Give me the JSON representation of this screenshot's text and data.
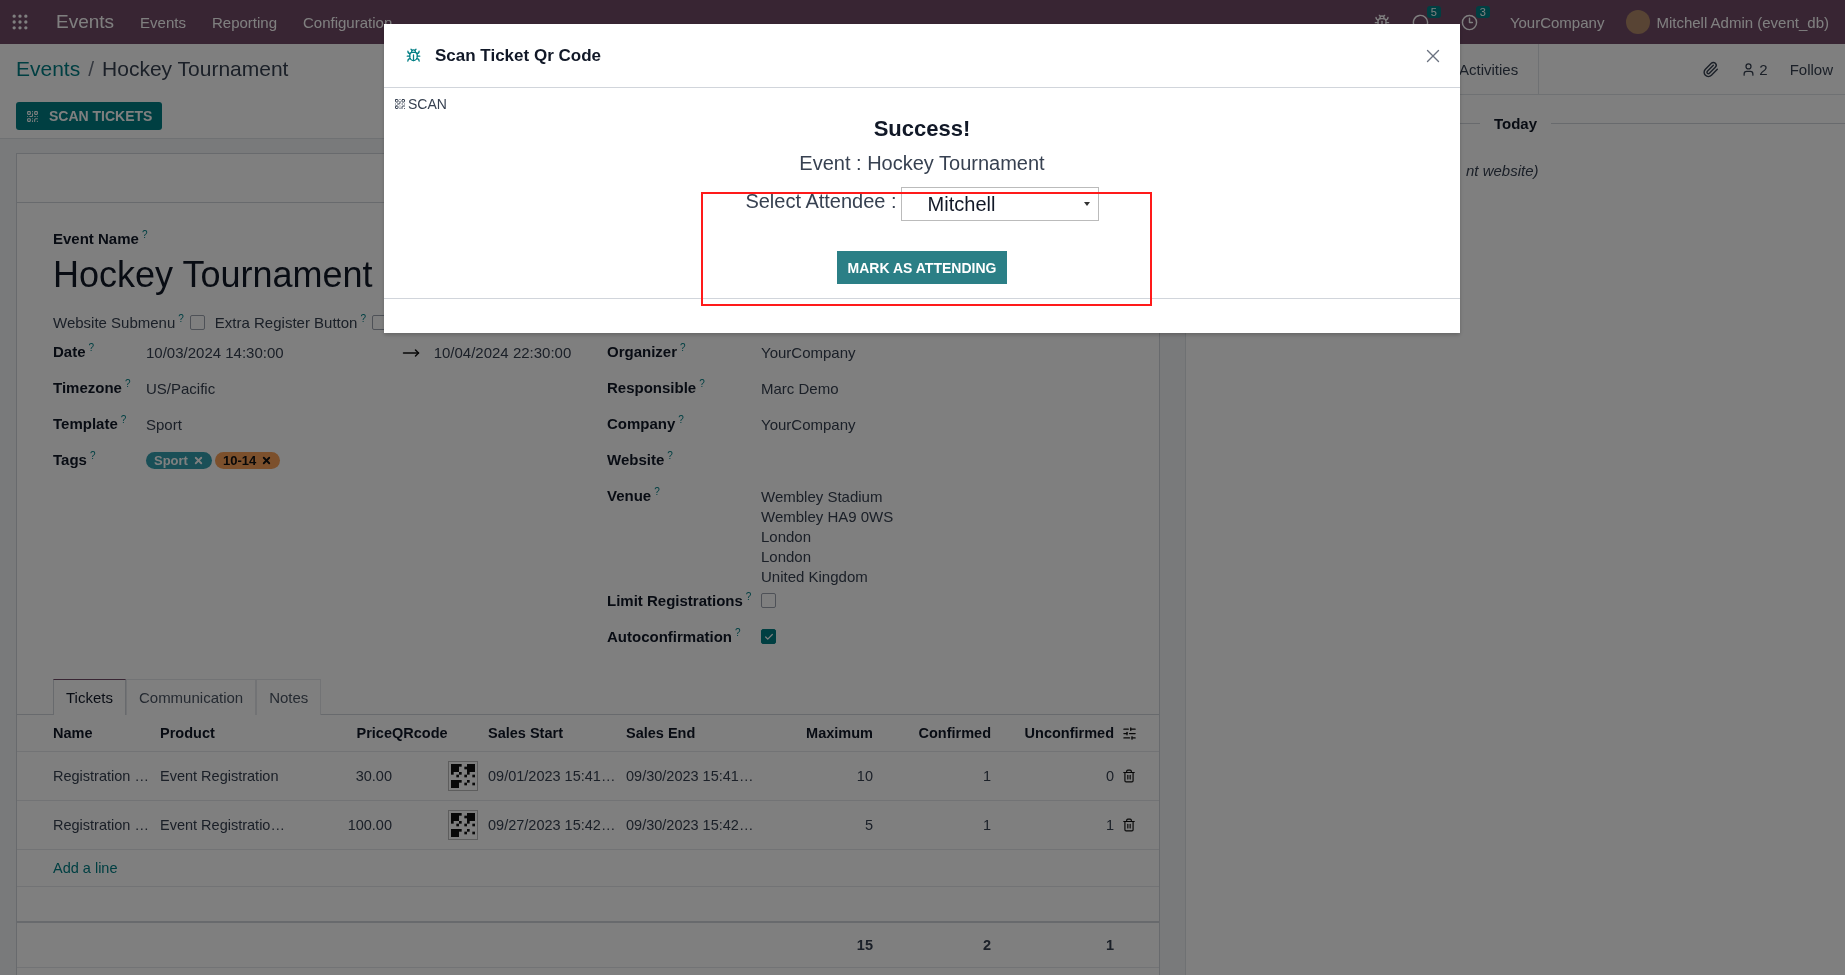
{
  "navbar": {
    "app": "Events",
    "menu": [
      "Events",
      "Reporting",
      "Configuration"
    ],
    "chat_badge": "5",
    "activity_badge": "3",
    "company": "YourCompany",
    "user": "Mitchell Admin (event_db)"
  },
  "breadcrumb": {
    "parent": "Events",
    "separator": "/",
    "current": "Hockey Tournament"
  },
  "scan_tickets_button": "SCAN TICKETS",
  "chatter": {
    "activities": "Activities",
    "followers": "2",
    "follow": "Follow",
    "date_divider": "Today",
    "message": "nt website)"
  },
  "form": {
    "name_label": "Event Name",
    "name_help": "?",
    "name": "Hockey Tournament",
    "options": [
      {
        "label": "Website Submenu",
        "help": "?",
        "checked": false
      },
      {
        "label": "Extra Register Button",
        "help": "?",
        "checked": false
      }
    ],
    "left_fields": [
      {
        "kind": "daterange",
        "label": "Date",
        "help": "?",
        "value": "10/03/2024 14:30:00",
        "end": "10/04/2024 22:30:00"
      },
      {
        "kind": "text",
        "label": "Timezone",
        "help": "?",
        "value": "US/Pacific"
      },
      {
        "kind": "text",
        "label": "Template",
        "help": "?",
        "value": "Sport"
      },
      {
        "kind": "tags",
        "label": "Tags",
        "help": "?",
        "tags": [
          {
            "label": "Sport",
            "color": "#1a4f57"
          },
          {
            "label": "10-14",
            "color": "#7c502c"
          }
        ]
      }
    ],
    "right_fields": [
      {
        "kind": "text",
        "label": "Organizer",
        "help": "?",
        "value": "YourCompany"
      },
      {
        "kind": "text",
        "label": "Responsible",
        "help": "?",
        "value": "Marc Demo"
      },
      {
        "kind": "text",
        "label": "Company",
        "help": "?",
        "value": "YourCompany"
      },
      {
        "kind": "text",
        "label": "Website",
        "help": "?"
      },
      {
        "kind": "lines",
        "label": "Venue",
        "help": "?",
        "lines": [
          "Wembley Stadium",
          "Wembley HA9 0WS",
          "London",
          "London",
          "United Kingdom"
        ]
      },
      {
        "kind": "checkbox",
        "label": "Limit Registrations",
        "help": "?",
        "checked": false
      },
      {
        "kind": "checkbox",
        "label": "Autoconfirmation",
        "help": "?",
        "checked": true
      }
    ]
  },
  "tabs": [
    {
      "label": "Tickets",
      "selected": true
    },
    {
      "label": "Communication",
      "selected": false
    },
    {
      "label": "Notes",
      "selected": false
    }
  ],
  "table": {
    "columns": [
      "Name",
      "Product",
      "Price",
      "QRcode",
      "Sales Start",
      "Sales End",
      "Maximum",
      "Confirmed",
      "Unconfirmed"
    ],
    "rows": [
      {
        "name": "Registration …",
        "product": "Event Registration",
        "price": "30.00",
        "sales_start": "09/01/2023 15:41…",
        "sales_end": "09/30/2023 15:41…",
        "maximum": "10",
        "confirmed": "1",
        "unconfirmed": "0"
      },
      {
        "name": "Registration …",
        "product": "Event Registratio…",
        "price": "100.00",
        "sales_start": "09/27/2023 15:42…",
        "sales_end": "09/30/2023 15:42…",
        "maximum": "5",
        "confirmed": "1",
        "unconfirmed": "1"
      }
    ],
    "add_line": "Add a line",
    "totals": {
      "maximum": "15",
      "confirmed": "2",
      "unconfirmed": "1"
    }
  },
  "dialog": {
    "title": "Scan Ticket Qr Code",
    "scan": "SCAN",
    "heading": "Success!",
    "event_line": "Event : Hockey Tournament",
    "select_label": "Select Attendee :",
    "attendee": "Mitchell",
    "button": "MARK AS ATTENDING"
  }
}
